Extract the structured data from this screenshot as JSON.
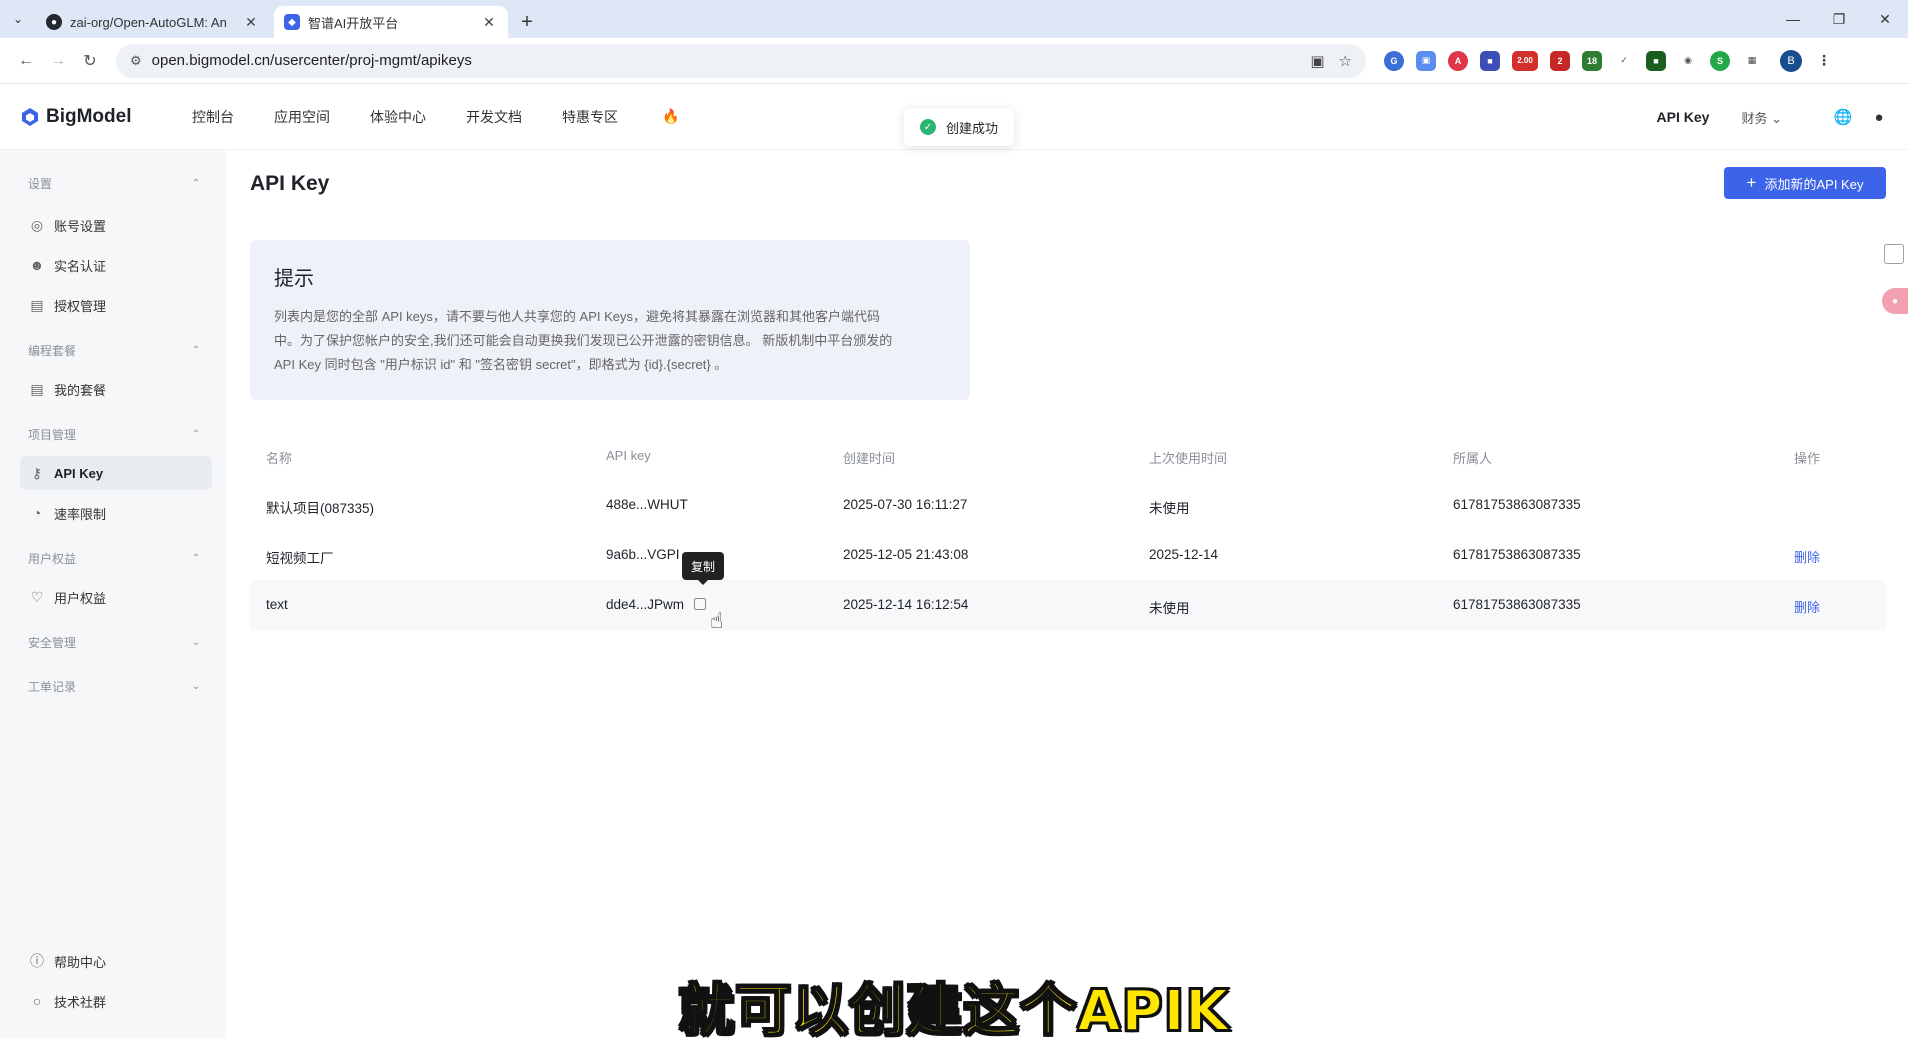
{
  "browser": {
    "tabs": [
      {
        "title": "zai-org/Open-AutoGLM: An",
        "active": false
      },
      {
        "title": "智谱AI开放平台",
        "active": true
      }
    ],
    "url": "open.bigmodel.cn/usercenter/proj-mgmt/apikeys",
    "extension_badges": [
      "2.00",
      "2",
      "18"
    ]
  },
  "header": {
    "logo": "BigModel",
    "nav": [
      "控制台",
      "应用空间",
      "体验中心",
      "开发文档",
      "特惠专区"
    ],
    "right_api_key": "API Key",
    "right_finance": "财务"
  },
  "toast": {
    "text": "创建成功"
  },
  "sidebar": {
    "sections": [
      {
        "label": "设置",
        "expanded": true
      },
      {
        "label": "编程套餐",
        "expanded": true
      },
      {
        "label": "项目管理",
        "expanded": true
      },
      {
        "label": "用户权益",
        "expanded": true
      },
      {
        "label": "安全管理",
        "expanded": false
      },
      {
        "label": "工单记录",
        "expanded": false
      }
    ],
    "items": [
      {
        "label": "账号设置",
        "icon": "account-settings-icon"
      },
      {
        "label": "实名认证",
        "icon": "user-verify-icon"
      },
      {
        "label": "授权管理",
        "icon": "authorization-icon"
      },
      {
        "label": "我的套餐",
        "icon": "package-icon"
      },
      {
        "label": "API Key",
        "icon": "key-icon",
        "active": true
      },
      {
        "label": "速率限制",
        "icon": "rate-limit-icon"
      },
      {
        "label": "用户权益",
        "icon": "benefit-icon"
      }
    ],
    "bottom": [
      {
        "label": "帮助中心",
        "icon": "help-icon"
      },
      {
        "label": "技术社群",
        "icon": "community-icon"
      }
    ]
  },
  "main": {
    "title": "API Key",
    "add_button": "添加新的API Key",
    "tip": {
      "heading": "提示",
      "line1": "列表内是您的全部 API keys，请不要与他人共享您的 API Keys，避免将其暴露在浏览器和其他客户端代码",
      "line2": "中。为了保护您帐户的安全,我们还可能会自动更换我们发现已公开泄露的密钥信息。 新版机制中平台颁发的",
      "line3": "API Key 同时包含 \"用户标识 id\" 和 \"签名密钥 secret\"，即格式为 {id}.{secret} 。"
    },
    "table": {
      "columns": [
        "名称",
        "API key",
        "创建时间",
        "上次使用时间",
        "所属人",
        "操作"
      ],
      "rows": [
        {
          "name": "默认项目(087335)",
          "key": "488e...WHUT",
          "created": "2025-07-30 16:11:27",
          "last_used": "未使用",
          "owner": "61781753863087335",
          "action": ""
        },
        {
          "name": "短视频工厂",
          "key": "9a6b...VGPI",
          "created": "2025-12-05 21:43:08",
          "last_used": "2025-12-14",
          "owner": "61781753863087335",
          "action": "删除"
        },
        {
          "name": "text",
          "key": "dde4...JPwm",
          "created": "2025-12-14 16:12:54",
          "last_used": "未使用",
          "owner": "61781753863087335",
          "action": "删除"
        }
      ]
    },
    "tooltip": "复制"
  },
  "video_subtitle": "就可以创建这个APIK"
}
